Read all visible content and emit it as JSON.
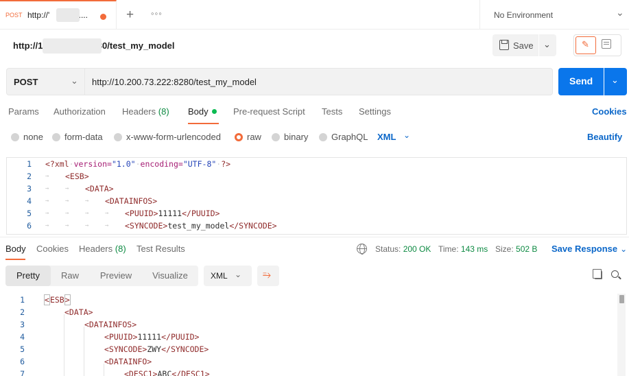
{
  "tab": {
    "method": "POST",
    "title": "http://'          '3...."
  },
  "environment": {
    "label": "No Environment"
  },
  "request_name": "http://1                  8280/test_my_model",
  "toolbar": {
    "save_label": "Save"
  },
  "request": {
    "method": "POST",
    "url": "http://10.200.73.222:8280/test_my_model",
    "send_label": "Send"
  },
  "request_tabs": {
    "params": "Params",
    "authorization": "Authorization",
    "headers": "Headers",
    "headers_count": "(8)",
    "body": "Body",
    "prerequest": "Pre-request Script",
    "tests": "Tests",
    "settings": "Settings",
    "cookies": "Cookies"
  },
  "body_types": {
    "none": "none",
    "form_data": "form-data",
    "urlencoded": "x-www-form-urlencoded",
    "raw": "raw",
    "binary": "binary",
    "graphql": "GraphQL",
    "language": "XML",
    "beautify": "Beautify",
    "selected": "raw"
  },
  "request_body": {
    "line_numbers": [
      "1",
      "2",
      "3",
      "4",
      "5",
      "6"
    ],
    "decl_open": "<?xml",
    "decl_version_attr": "version=",
    "decl_version_val": "\"1.0\"",
    "decl_encoding_attr": "encoding=",
    "decl_encoding_val": "\"UTF-8\"",
    "decl_close": "?>",
    "l2": "<ESB>",
    "l3": "<DATA>",
    "l4": "<DATAINFOS>",
    "l5_open": "<PUUID>",
    "l5_text": "11111",
    "l5_close": "</PUUID>",
    "l6_open": "<SYNCODE>",
    "l6_text": "test_my_model",
    "l6_close": "</SYNCODE>"
  },
  "response_tabs": {
    "body": "Body",
    "cookies": "Cookies",
    "headers": "Headers",
    "headers_count": "(8)",
    "test_results": "Test Results"
  },
  "response_status": {
    "status_label": "Status:",
    "status_value": "200 OK",
    "time_label": "Time:",
    "time_value": "143 ms",
    "size_label": "Size:",
    "size_value": "502 B",
    "save_response": "Save Response"
  },
  "response_view": {
    "pretty": "Pretty",
    "raw": "Raw",
    "preview": "Preview",
    "visualize": "Visualize",
    "format": "XML"
  },
  "response_body": {
    "line_numbers": [
      "1",
      "2",
      "3",
      "4",
      "5",
      "6",
      "7"
    ],
    "l1": "ESB",
    "l2": "<DATA>",
    "l3": "<DATAINFOS>",
    "l4_open": "<PUUID>",
    "l4_text": "11111",
    "l4_close": "</PUUID>",
    "l5_open": "<SYNCODE>",
    "l5_text": "ZWY",
    "l5_close": "</SYNCODE>",
    "l6": "<DATAINFO>",
    "l7_open": "<DESC1>",
    "l7_text": "ABC",
    "l7_close": "</DESC1>"
  },
  "colors": {
    "accent": "#f26b3a",
    "primary": "#0a76eb",
    "link": "#0b67c9",
    "success": "#0d8a42"
  },
  "icons": [
    "plus-icon",
    "more-icon",
    "chevron-down-icon",
    "save-icon",
    "pencil-icon",
    "document-icon",
    "globe-icon",
    "wrap-icon",
    "copy-icon",
    "search-icon"
  ]
}
